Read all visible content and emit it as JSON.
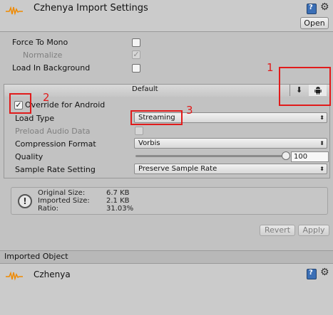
{
  "header": {
    "title": "Czhenya Import Settings",
    "open_label": "Open",
    "file_icon": "audio-waveform-icon",
    "help_icon": "help-book-icon",
    "settings_icon": "gear-icon"
  },
  "general": {
    "force_to_mono": {
      "label": "Force To Mono",
      "checked": false
    },
    "normalize": {
      "label": "Normalize",
      "checked": true,
      "disabled": true
    },
    "load_in_background": {
      "label": "Load In Background",
      "checked": false
    }
  },
  "platforms": {
    "default_label": "Default",
    "tabs": [
      {
        "icon": "download-icon",
        "glyph": "⬇",
        "active": false
      },
      {
        "icon": "android-icon",
        "glyph": "🤖",
        "active": true
      }
    ]
  },
  "android": {
    "override": {
      "label": "Override for Android",
      "checked": true
    },
    "load_type": {
      "label": "Load Type",
      "value": "Streaming"
    },
    "preload_audio_data": {
      "label": "Preload Audio Data",
      "checked": false,
      "disabled": true
    },
    "compression_format": {
      "label": "Compression Format",
      "value": "Vorbis"
    },
    "quality": {
      "label": "Quality",
      "value": "100",
      "level_percent": 100
    },
    "sample_rate_setting": {
      "label": "Sample Rate Setting",
      "value": "Preserve Sample Rate"
    }
  },
  "info": {
    "original_size_label": "Original Size:",
    "original_size_value": "6.7 KB",
    "imported_size_label": "Imported Size:",
    "imported_size_value": "2.1 KB",
    "ratio_label": "Ratio:",
    "ratio_value": "31.03%"
  },
  "actions": {
    "revert_label": "Revert",
    "apply_label": "Apply"
  },
  "imported_object": {
    "section_label": "Imported Object",
    "name": "Czhenya"
  },
  "annotations": {
    "one": "1",
    "two": "2",
    "three": "3",
    "color": "#e11b1b"
  }
}
